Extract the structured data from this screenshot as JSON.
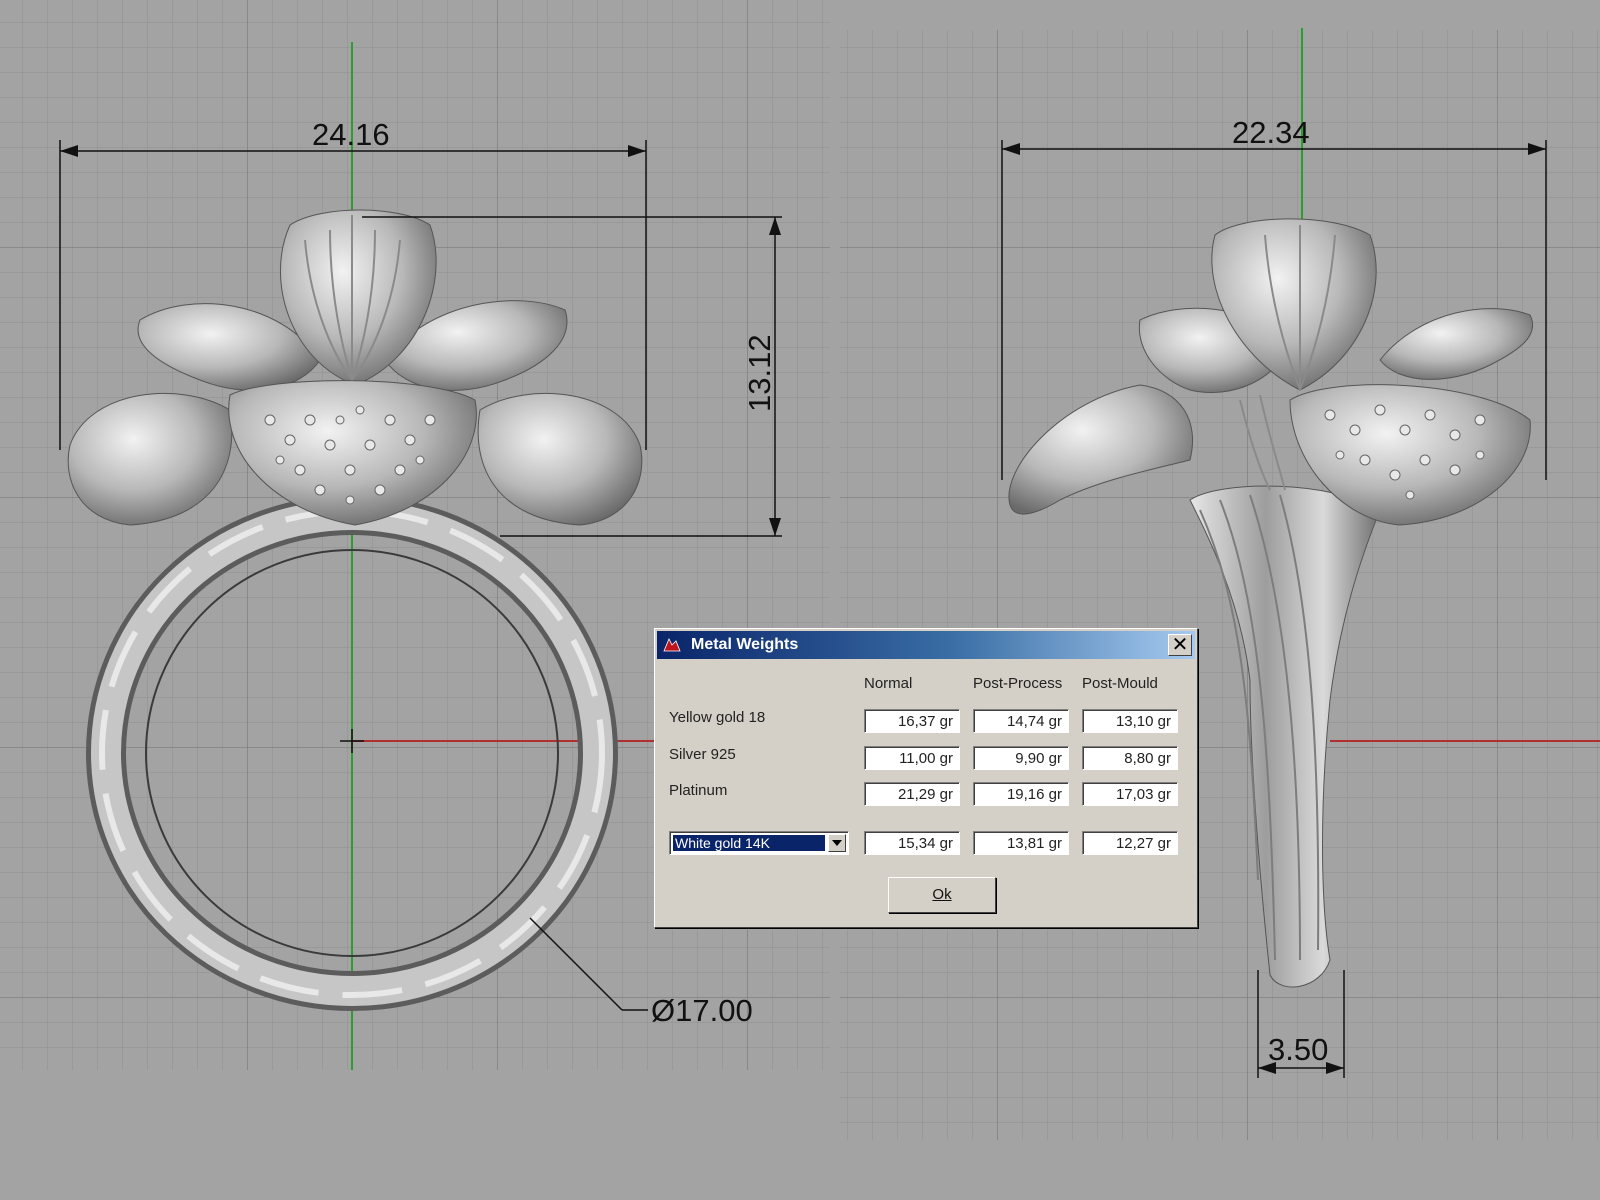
{
  "dimensions": {
    "front_width": "24.16",
    "front_height": "13.12",
    "ring_diameter": "Ø17.00",
    "side_width": "22.34",
    "shank_width": "3.50"
  },
  "dialog": {
    "title": "Metal Weights",
    "close_symbol": "✕",
    "columns": [
      "Normal",
      "Post-Process",
      "Post-Mould"
    ],
    "rows": [
      {
        "label": "Yellow gold 18",
        "values": [
          "16,37 gr",
          "14,74 gr",
          "13,10 gr"
        ]
      },
      {
        "label": "Silver 925",
        "values": [
          "11,00 gr",
          "9,90 gr",
          "8,80 gr"
        ]
      },
      {
        "label": "Platinum",
        "values": [
          "21,29 gr",
          "19,16 gr",
          "17,03 gr"
        ]
      }
    ],
    "custom_row": {
      "selected_metal": "White gold 14K",
      "values": [
        "15,34 gr",
        "13,81 gr",
        "12,27 gr"
      ]
    },
    "ok_label": "Ok"
  },
  "colors": {
    "background": "#a3a3a3",
    "grid": "#8e8e8e",
    "y_axis": "#2aa02a",
    "x_axis": "#b03030",
    "title_bar": "#0a246a"
  }
}
